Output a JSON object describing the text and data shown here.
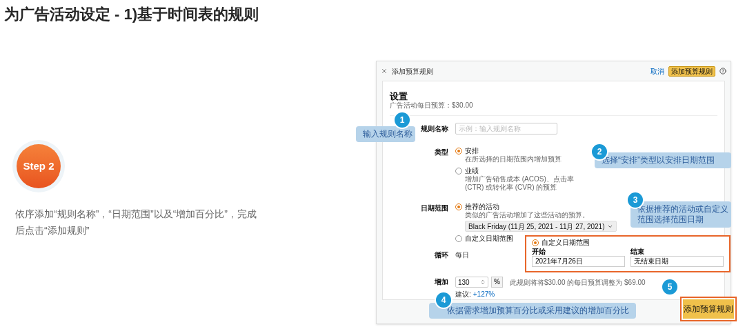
{
  "title": "为广告活动设定 - 1)基于时间表的规则",
  "step": {
    "label": "Step 2"
  },
  "description": "依序添加“规则名称”，“日期范围”以及“增加百分比”，完成后点击“添加规则”",
  "dialog": {
    "title": "添加预算规则",
    "cancel": "取消",
    "submit": "添加预算规则"
  },
  "settings": {
    "heading": "设置",
    "budget": "广告活动每日预算：$30.00"
  },
  "rule_name": {
    "label": "规则名称",
    "placeholder": "示例：输入规则名称"
  },
  "type": {
    "label": "类型",
    "options": [
      {
        "label": "安排",
        "description": "在所选择的日期范围内增加预算",
        "selected": true
      },
      {
        "label": "业绩",
        "description": "增加广告销售成本 (ACOS)、点击率 (CTR) 或转化率 (CVR) 的预算",
        "selected": false
      }
    ]
  },
  "date_range": {
    "label": "日期范围",
    "options": [
      {
        "label": "推荐的活动",
        "description": "类似的广告活动增加了这些活动的预算。",
        "selected": true,
        "dropdown": "Black Friday (11月 25, 2021 - 11月 27, 2021)"
      },
      {
        "label": "自定义日期范围",
        "selected": false
      }
    ]
  },
  "custom_range": {
    "label": "自定义日期范围",
    "selected": true,
    "start_label": "开始",
    "start": "2021年7月26日",
    "end_label": "结束",
    "end": "无结束日期"
  },
  "recurrence": {
    "label": "循环",
    "value": "每日"
  },
  "increase": {
    "label": "增加",
    "value": "130",
    "unit": "%",
    "summary": "此规则将将$30.00 的每日预算调整为 $69.00",
    "suggestion_label": "建议:",
    "suggestion": "+127%"
  },
  "footer_button": "添加预算规则",
  "callouts": [
    {
      "number": "1",
      "text": "输入规则名称"
    },
    {
      "number": "2",
      "text": "选择“安排”类型以安排日期范围"
    },
    {
      "number": "3",
      "text": "依据推荐的活动或自定义范围选择范围日期"
    },
    {
      "number": "4",
      "text": "依据需求增加预算百分比或采用建议的增加百分比"
    },
    {
      "number": "5"
    }
  ]
}
